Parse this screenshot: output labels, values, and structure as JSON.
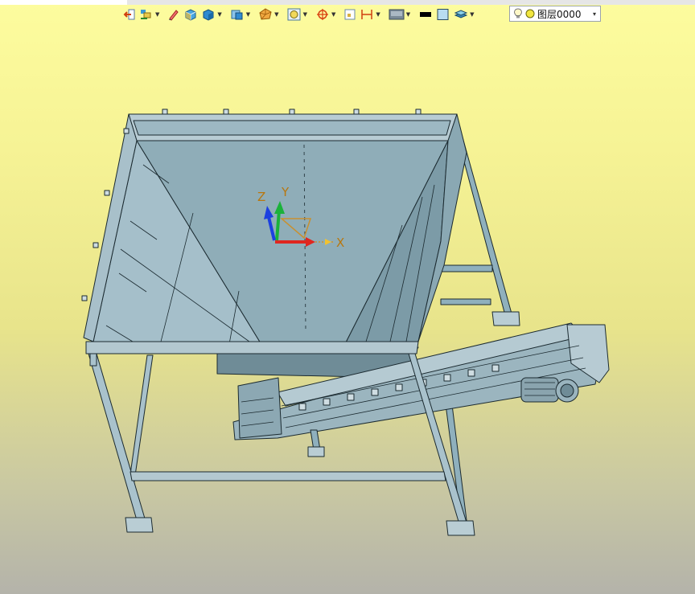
{
  "toolbar": {
    "layer_name": "图层0000",
    "tools": [
      "exit-icon",
      "render-mode-icon",
      "pen-icon",
      "cube-icon",
      "solid-icon",
      "view-icon",
      "polyhedron-icon",
      "zoom-fit-icon",
      "snap-icon",
      "box-icon",
      "dimension-icon",
      "display-style-icon",
      "line-color-icon",
      "fill-color-icon",
      "layers-icon"
    ]
  },
  "viewport": {
    "axes": {
      "x": "X",
      "y": "Y",
      "z": "Z"
    },
    "colors": {
      "part_fill": "#8fb0bd",
      "edge": "#1b2a30",
      "axis_x": "#e0261f",
      "axis_y": "#1ab23a",
      "axis_z": "#1c40e0"
    }
  }
}
